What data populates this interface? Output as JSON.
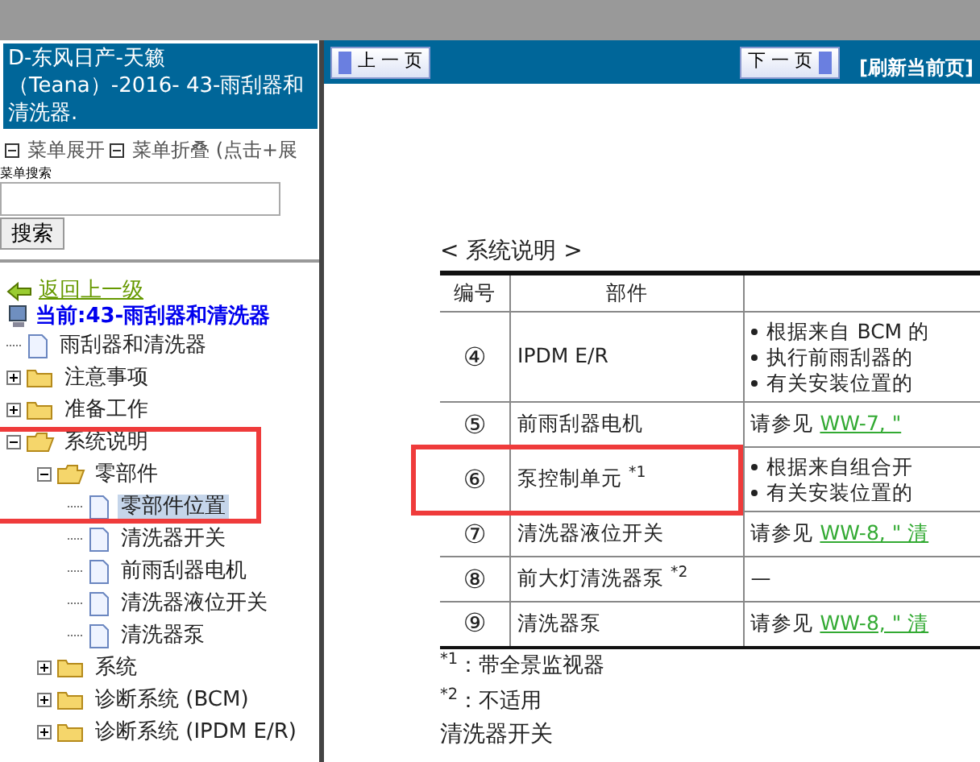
{
  "sidebar": {
    "title": "D-东风日产-天籁（Teana）-2016- 43-雨刮器和清洗器.",
    "menu_links": [
      {
        "label": "菜单展开"
      },
      {
        "label": "菜单折叠 (点击+展"
      }
    ],
    "search": {
      "label": "菜单搜索",
      "button": "搜索"
    },
    "back_link": "返回上一级",
    "current": "当前:43-雨刮器和清洗器",
    "tree": [
      {
        "label": "雨刮器和清洗器",
        "kind": "page",
        "selected": false,
        "highlighted": false
      },
      {
        "label": "注意事项",
        "kind": "folder",
        "expanded": false,
        "highlighted": false
      },
      {
        "label": "准备工作",
        "kind": "folder",
        "expanded": false,
        "highlighted": false
      },
      {
        "label": "系统说明",
        "kind": "folder",
        "expanded": true,
        "highlighted": true,
        "children": [
          {
            "label": "零部件",
            "kind": "folder",
            "expanded": true,
            "highlighted": true,
            "children": [
              {
                "label": "零部件位置",
                "kind": "page",
                "selected": true,
                "highlighted": true
              },
              {
                "label": "清洗器开关",
                "kind": "page",
                "selected": false,
                "highlighted": false
              },
              {
                "label": "前雨刮器电机",
                "kind": "page",
                "selected": false,
                "highlighted": false
              },
              {
                "label": "清洗器液位开关",
                "kind": "page",
                "selected": false,
                "highlighted": false
              },
              {
                "label": "清洗器泵",
                "kind": "page",
                "selected": false,
                "highlighted": false
              }
            ]
          },
          {
            "label": "系统",
            "kind": "folder",
            "expanded": false,
            "highlighted": false
          },
          {
            "label": "诊断系统 (BCM)",
            "kind": "folder",
            "expanded": false,
            "highlighted": false
          },
          {
            "label": "诊断系统 (IPDM E/R)",
            "kind": "folder",
            "expanded": false,
            "highlighted": false
          }
        ]
      }
    ]
  },
  "toolbar": {
    "prev": "上 一 页",
    "next": "下 一 页",
    "refresh": "[刷新当前页]"
  },
  "document": {
    "heading": "< 系统说明 >",
    "columns": [
      "编号",
      "部件"
    ],
    "rows": [
      {
        "number": "④",
        "part": "IPDM E/R",
        "highlighted": false,
        "description": {
          "kind": "bullets",
          "items": [
            "根据来自 BCM 的",
            "执行前雨刮器的",
            "有关安装位置的"
          ]
        }
      },
      {
        "number": "⑤",
        "part": "前雨刮器电机",
        "highlighted": false,
        "description": {
          "kind": "reference",
          "text": "请参见",
          "link": "WW-7, \""
        }
      },
      {
        "number": "⑥",
        "part": "泵控制单元 $^{*1}$",
        "highlighted": true,
        "description": {
          "kind": "bullets",
          "items": [
            "根据来自组合开",
            "有关安装位置的"
          ]
        }
      },
      {
        "number": "⑦",
        "part": "清洗器液位开关",
        "highlighted": false,
        "description": {
          "kind": "reference",
          "text": "请参见",
          "link": "WW-8, \" 清"
        }
      },
      {
        "number": "⑧",
        "part": "前大灯清洗器泵 $^{*2}$",
        "highlighted": false,
        "description": {
          "kind": "plain",
          "text": "—"
        }
      },
      {
        "number": "⑨",
        "part": "清洗器泵",
        "highlighted": false,
        "description": {
          "kind": "reference",
          "text": "请参见",
          "link": "WW-8, \" 清"
        }
      }
    ],
    "footnotes": [
      "$^{*1}$：带全景监视器",
      "$^{*2}$：不适用"
    ],
    "next_heading": "清洗器开关"
  }
}
